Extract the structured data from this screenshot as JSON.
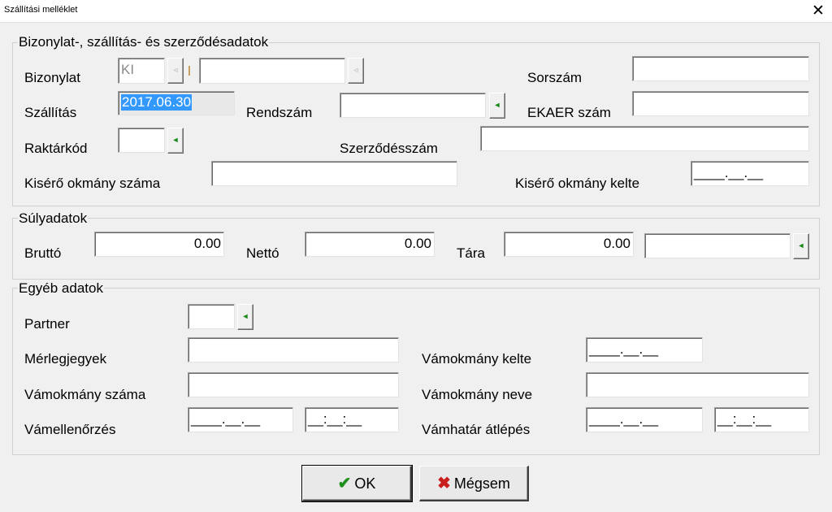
{
  "window": {
    "title": "Szállítási melléklet",
    "close_glyph": "✕"
  },
  "group_doc": {
    "legend": "Bizonylat-, szállítás- és szerződésadatok",
    "bizonylat_label": "Bizonylat",
    "bizonylat_code": "KI",
    "bizonylat_number": "",
    "sorszam_label": "Sorszám",
    "sorszam_value": "",
    "szallitas_label": "Szállítás",
    "szallitas_value": "2017.06.30",
    "rendszam_label": "Rendszám",
    "rendszam_value": "",
    "ekaer_label": "EKAER szám",
    "ekaer_value": "",
    "raktarkod_label": "Raktárkód",
    "raktarkod_value": "",
    "szerzodes_label": "Szerződésszám",
    "szerzodes_value": "",
    "kisero_szam_label": "Kisérő okmány száma",
    "kisero_szam_value": "",
    "kisero_kelte_label": "Kisérő okmány kelte",
    "kisero_kelte_value": "____.__.__"
  },
  "group_weight": {
    "legend": "Súlyadatok",
    "brutto_label": "Bruttó",
    "brutto_value": "0.00",
    "netto_label": "Nettó",
    "netto_value": "0.00",
    "tara_label": "Tára",
    "tara_value": "0.00",
    "unit_value": ""
  },
  "group_other": {
    "legend": "Egyéb adatok",
    "partner_label": "Partner",
    "partner_value": "",
    "merlegjegy_label": "Mérlegjegyek",
    "merlegjegy_value": "",
    "vamokmany_kelte_label": "Vámokmány kelte",
    "vamokmany_kelte_value": "____.__.__",
    "vamokmany_szama_label": "Vámokmány száma",
    "vamokmany_szama_value": "",
    "vamokmany_neve_label": "Vámokmány neve",
    "vamokmany_neve_value": "",
    "vamellenorzes_label": "Vámellenőrzés",
    "vamellenorzes_date": "____.__.__",
    "vamellenorzes_time": "__:__:__",
    "vamhatar_label": "Vámhatár átlépés",
    "vamhatar_date": "____.__.__",
    "vamhatar_time": "__:__:__"
  },
  "buttons": {
    "ok_label": "OK",
    "ok_icon": "✔",
    "cancel_label": "Mégsem",
    "cancel_icon": "✖"
  },
  "icons": {
    "picker_arrow": "◂",
    "picker_disabled": "◃"
  }
}
